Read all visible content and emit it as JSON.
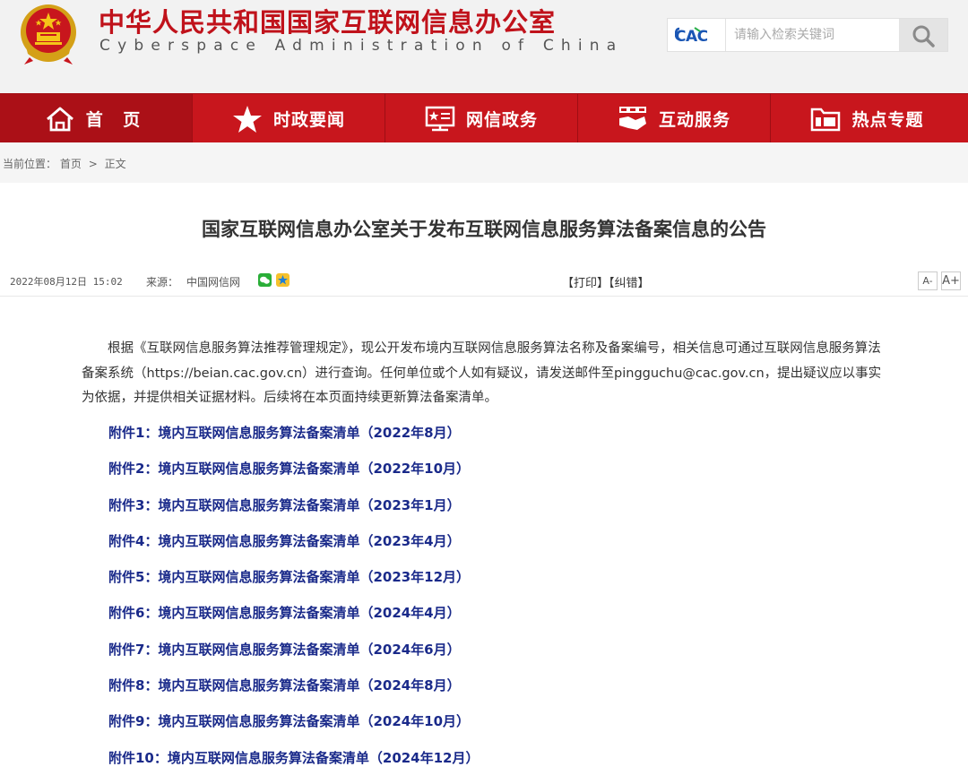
{
  "header": {
    "title_cn": "中华人民共和国国家互联网信息办公室",
    "title_en": "Cyberspace Administration of China",
    "logo_text": "CAC",
    "search_placeholder": "请输入检索关键词"
  },
  "nav": {
    "items": [
      {
        "label": "首 页",
        "icon": "home-icon"
      },
      {
        "label": "时政要闻",
        "icon": "star-icon"
      },
      {
        "label": "网信政务",
        "icon": "monitor-icon"
      },
      {
        "label": "互动服务",
        "icon": "handshake-icon"
      },
      {
        "label": "热点专题",
        "icon": "folder-icon"
      }
    ]
  },
  "breadcrumb": {
    "prefix": "当前位置：",
    "home": "首页",
    "separator": ">",
    "current": "正文"
  },
  "article": {
    "title": "国家互联网信息办公室关于发布互联网信息服务算法备案信息的公告",
    "date": "2022年08月12日 15:02",
    "source_label": "来源：",
    "source": "中国网信网",
    "print_label": "【打印】【纠错】",
    "font_small": "A-",
    "font_large": "A+",
    "body": "根据《互联网信息服务算法推荐管理规定》，现公开发布境内互联网信息服务算法名称及备案编号，相关信息可通过互联网信息服务算法备案系统（https://beian.cac.gov.cn）进行查询。任何单位或个人如有疑议，请发送邮件至pingguchu@cac.gov.cn，提出疑议应以事实为依据，并提供相关证据材料。后续将在本页面持续更新算法备案清单。",
    "attachments": [
      "附件1：境内互联网信息服务算法备案清单（2022年8月）",
      "附件2：境内互联网信息服务算法备案清单（2022年10月）",
      "附件3：境内互联网信息服务算法备案清单（2023年1月）",
      "附件4：境内互联网信息服务算法备案清单（2023年4月）",
      "附件5：境内互联网信息服务算法备案清单（2023年12月）",
      "附件6：境内互联网信息服务算法备案清单（2024年4月）",
      "附件7：境内互联网信息服务算法备案清单（2024年6月）",
      "附件8：境内互联网信息服务算法备案清单（2024年8月）",
      "附件9：境内互联网信息服务算法备案清单（2024年10月）",
      "附件10：境内互联网信息服务算法备案清单（2024年12月）"
    ]
  },
  "colors": {
    "brand_red": "#c8161d",
    "link_blue": "#1a2a8a"
  }
}
